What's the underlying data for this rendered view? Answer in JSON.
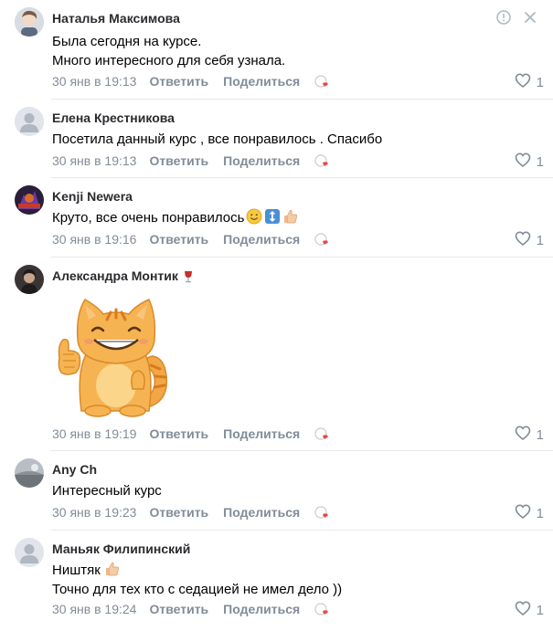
{
  "comments": [
    {
      "author": "Наталья Максимова",
      "lines": [
        "Была сегодня на курсе.",
        "Много интересного для себя узнала."
      ],
      "date": "30 янв в 19:13",
      "reply": "Ответить",
      "share": "Поделиться",
      "likes": "1"
    },
    {
      "author": "Елена Крестникова",
      "lines": [
        "Посетила данный курс , все понравилось . Спасибо"
      ],
      "date": "30 янв в 19:13",
      "reply": "Ответить",
      "share": "Поделиться",
      "likes": "1"
    },
    {
      "author": "Kenji Newera",
      "lines": [
        "Круто, все очень понравилось"
      ],
      "date": "30 янв в 19:16",
      "reply": "Ответить",
      "share": "Поделиться",
      "likes": "1",
      "emojis": [
        "smile",
        "up-down-arrow",
        "thumbs-up"
      ]
    },
    {
      "author": "Александра Монтик",
      "author_emoji": "wine-glass",
      "sticker": "cat-thumbs-up",
      "date": "30 янв в 19:19",
      "reply": "Ответить",
      "share": "Поделиться",
      "likes": "1"
    },
    {
      "author": "Any Ch",
      "lines": [
        "Интересный курс"
      ],
      "date": "30 янв в 19:23",
      "reply": "Ответить",
      "share": "Поделиться",
      "likes": "1"
    },
    {
      "author": "Маньяк Филипинский",
      "lines": [
        "Ништяк",
        "Точно для тех кто с седацией не имел дело ))"
      ],
      "date": "30 янв в 19:24",
      "reply": "Ответить",
      "share": "Поделиться",
      "likes": "1",
      "emojis": [
        "thumbs-up"
      ]
    }
  ],
  "icons": {
    "report": "report-icon",
    "close": "close-icon",
    "like": "heart-icon",
    "reactions": "reactions-icon"
  },
  "colors": {
    "author": "#2a2b2e",
    "meta": "#818c99",
    "separator": "#e7e8ec",
    "heart_red": "#e64646"
  }
}
